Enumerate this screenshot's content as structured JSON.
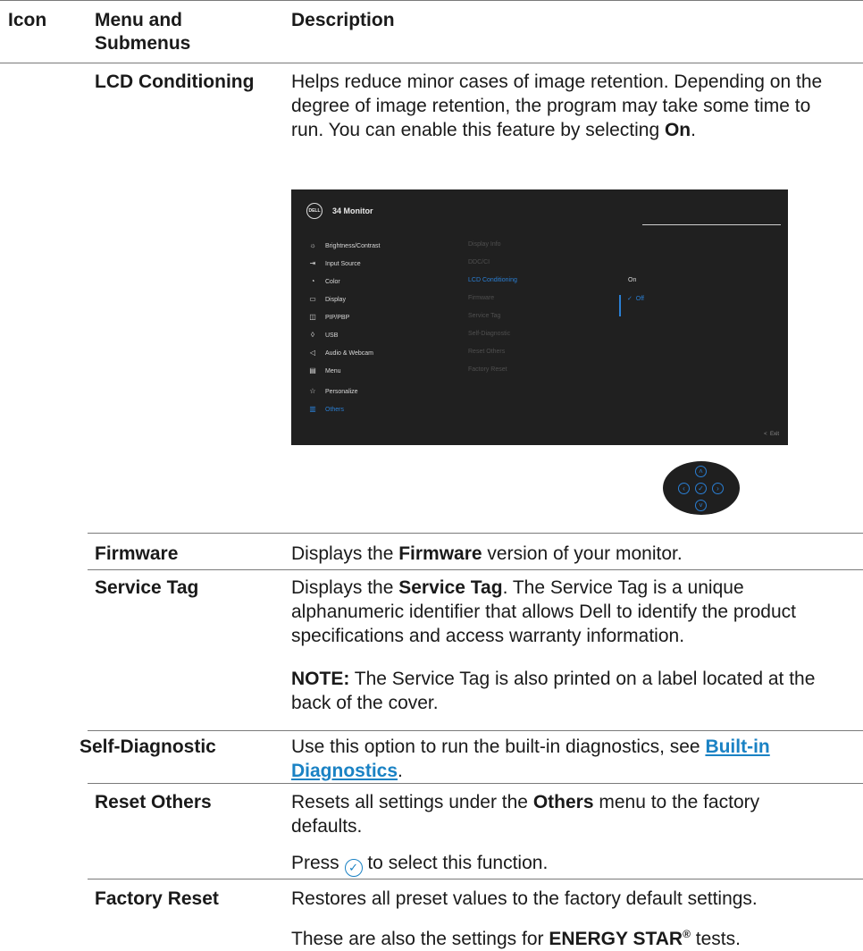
{
  "header": {
    "col_icon": "Icon",
    "col_menu": "Menu and Submenus",
    "col_desc": "Description"
  },
  "rows": {
    "lcd": {
      "menu": "LCD Conditioning",
      "desc_plain": "Helps reduce minor cases of image retention. Depending on the degree of image retention, the program may take some time to run. You can enable this feature by selecting ",
      "desc_bold": "On",
      "desc_end": "."
    },
    "firmware": {
      "menu": "Firmware",
      "desc_pre": "Displays the ",
      "desc_bold": "Firmware",
      "desc_post": " version of your monitor."
    },
    "service_tag": {
      "menu": "Service Tag",
      "desc_pre": "Displays the ",
      "desc_bold": "Service Tag",
      "desc_post": ". The Service Tag is a unique alphanumeric identifier that allows Dell to identify the product specifications and access warranty information.",
      "note_label": "NOTE:",
      "note_text": " The Service Tag is also printed on a label located at the back of the cover."
    },
    "self_diag": {
      "menu": "Self-Diagnostic",
      "desc_pre": "Use this option to run the built-in diagnostics, see ",
      "link": "Built-in Diagnostics",
      "desc_post": "."
    },
    "reset_others": {
      "menu": "Reset Others",
      "desc_pre": "Resets all settings under the ",
      "desc_bold": "Others",
      "desc_post": " menu to the factory defaults.",
      "press_pre": "Press ",
      "press_post": " to select this function."
    },
    "factory_reset": {
      "menu": "Factory Reset",
      "desc": "Restores all preset values to the factory default settings.",
      "energy_pre": "These are also the settings for ",
      "energy_bold": "ENERGY STAR",
      "energy_sup": "®",
      "energy_post": " tests."
    }
  },
  "osd": {
    "logo": "DELL",
    "title": "34 Monitor",
    "main_menu": [
      {
        "icon": "brightness-icon",
        "label": "Brightness/Contrast"
      },
      {
        "icon": "input-source-icon",
        "label": "Input Source"
      },
      {
        "icon": "color-icon",
        "label": "Color"
      },
      {
        "icon": "display-icon",
        "label": "Display"
      },
      {
        "icon": "pip-pbp-icon",
        "label": "PIP/PBP"
      },
      {
        "icon": "usb-icon",
        "label": "USB"
      },
      {
        "icon": "audio-icon",
        "label": "Audio & Webcam"
      },
      {
        "icon": "menu-icon",
        "label": "Menu"
      },
      {
        "icon": "star-icon",
        "label": "Personalize"
      },
      {
        "icon": "others-icon",
        "label": "Others"
      }
    ],
    "sub_menu": [
      "Display Info",
      "DDC/CI",
      "LCD Conditioning",
      "Firmware",
      "Service Tag",
      "Self-Diagnostic",
      "Reset Others",
      "Factory Reset"
    ],
    "options": [
      "On",
      "Off"
    ],
    "exit": "Exit",
    "colors": {
      "accent": "#2a7fd4",
      "background": "#202020",
      "link": "#1a82c4"
    }
  }
}
